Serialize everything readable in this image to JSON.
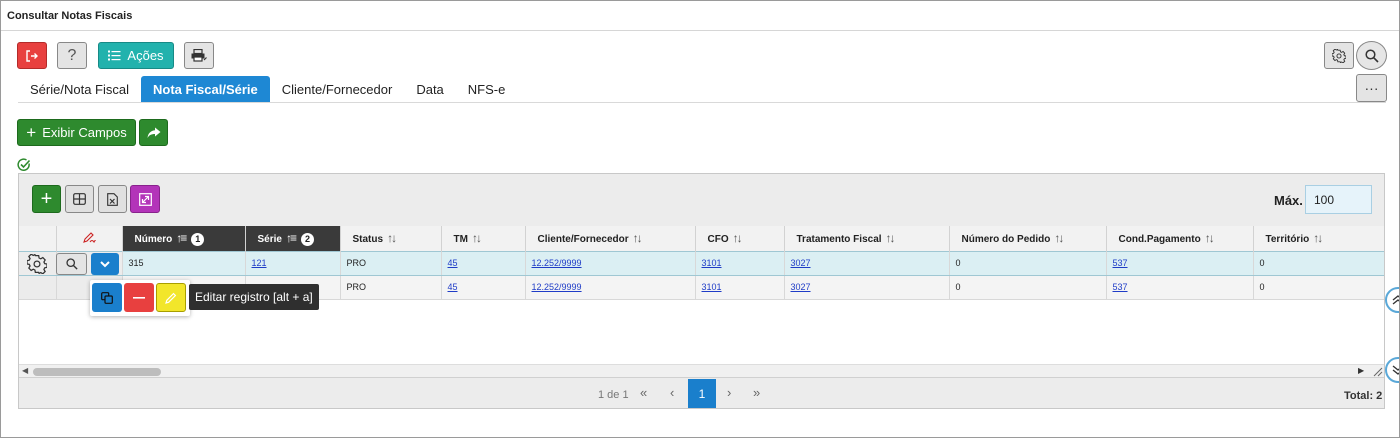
{
  "window": {
    "title": "Consultar Notas Fiscais"
  },
  "toolbar": {
    "exit_icon": "exit-icon",
    "help_label": "?",
    "actions_label": "Ações",
    "print_icon": "print-icon",
    "settings_icon": "gear-icon",
    "search_icon": "search-icon",
    "more_label": "···"
  },
  "tabs": [
    {
      "label": "Série/Nota Fiscal",
      "active": false
    },
    {
      "label": "Nota Fiscal/Série",
      "active": true
    },
    {
      "label": "Cliente/Fornecedor",
      "active": false
    },
    {
      "label": "Data",
      "active": false
    },
    {
      "label": "NFS-e",
      "active": false
    }
  ],
  "filters": {
    "show_fields_label": "Exibir Campos"
  },
  "grid": {
    "max_label": "Máx.",
    "max_value": "100",
    "columns": [
      {
        "label": "Número",
        "order": "1"
      },
      {
        "label": "Série",
        "order": "2"
      },
      {
        "label": "Status"
      },
      {
        "label": "TM"
      },
      {
        "label": "Cliente/Fornecedor"
      },
      {
        "label": "CFO"
      },
      {
        "label": "Tratamento Fiscal"
      },
      {
        "label": "Número do Pedido"
      },
      {
        "label": "Cond.Pagamento"
      },
      {
        "label": "Território"
      }
    ],
    "rows": [
      {
        "numero": "315",
        "serie": "121",
        "status": "PRO",
        "tm": "45",
        "cliente": "12.252/9999",
        "cfo": "3101",
        "tratamento": "3027",
        "pedido": "0",
        "cond": "537",
        "territorio": "0"
      },
      {
        "numero": "",
        "serie": "",
        "status": "PRO",
        "tm": "45",
        "cliente": "12.252/9999",
        "cfo": "3101",
        "tratamento": "3027",
        "pedido": "0",
        "cond": "537",
        "territorio": "0"
      }
    ],
    "tooltip": "Editar registro [alt + a]"
  },
  "pager": {
    "info": "1 de 1",
    "first": "«",
    "prev": "‹",
    "current": "1",
    "next": "›",
    "last": "»",
    "total": "Total: 2"
  },
  "colors": {
    "exit": "#e8403f",
    "actions": "#22b2ad",
    "tab_active": "#1e88d4",
    "green": "#2e8a2e",
    "purple": "#b334b9",
    "edit_yellow": "#f2e62a"
  }
}
